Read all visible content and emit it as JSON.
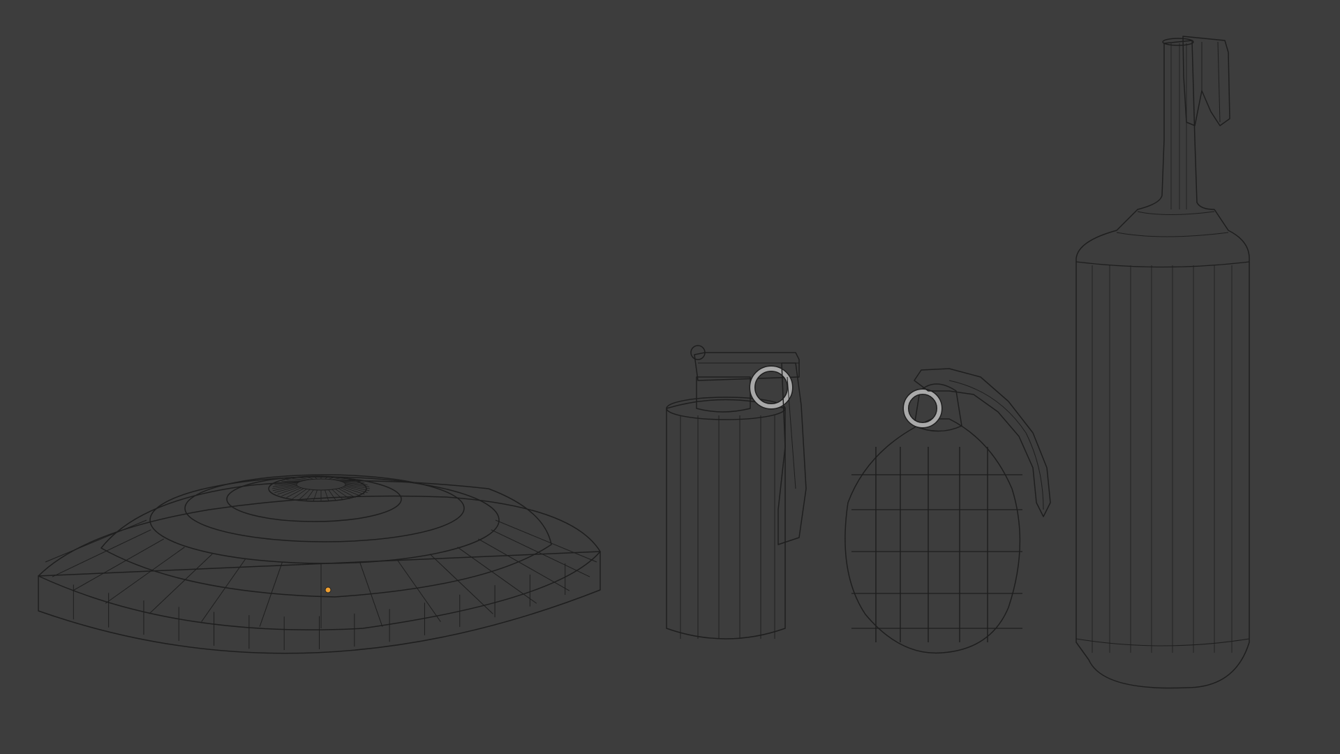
{
  "viewport": {
    "background": "#3d3d3d",
    "wire_color": "#1e1e1e",
    "origin_color": "#f0a030",
    "objects": [
      {
        "id": "landmine",
        "kind": "disc-mine"
      },
      {
        "id": "smoke-grenade",
        "kind": "cylinder-grenade"
      },
      {
        "id": "frag-grenade",
        "kind": "pineapple-grenade"
      },
      {
        "id": "bottle",
        "kind": "molotov-bottle"
      }
    ]
  }
}
